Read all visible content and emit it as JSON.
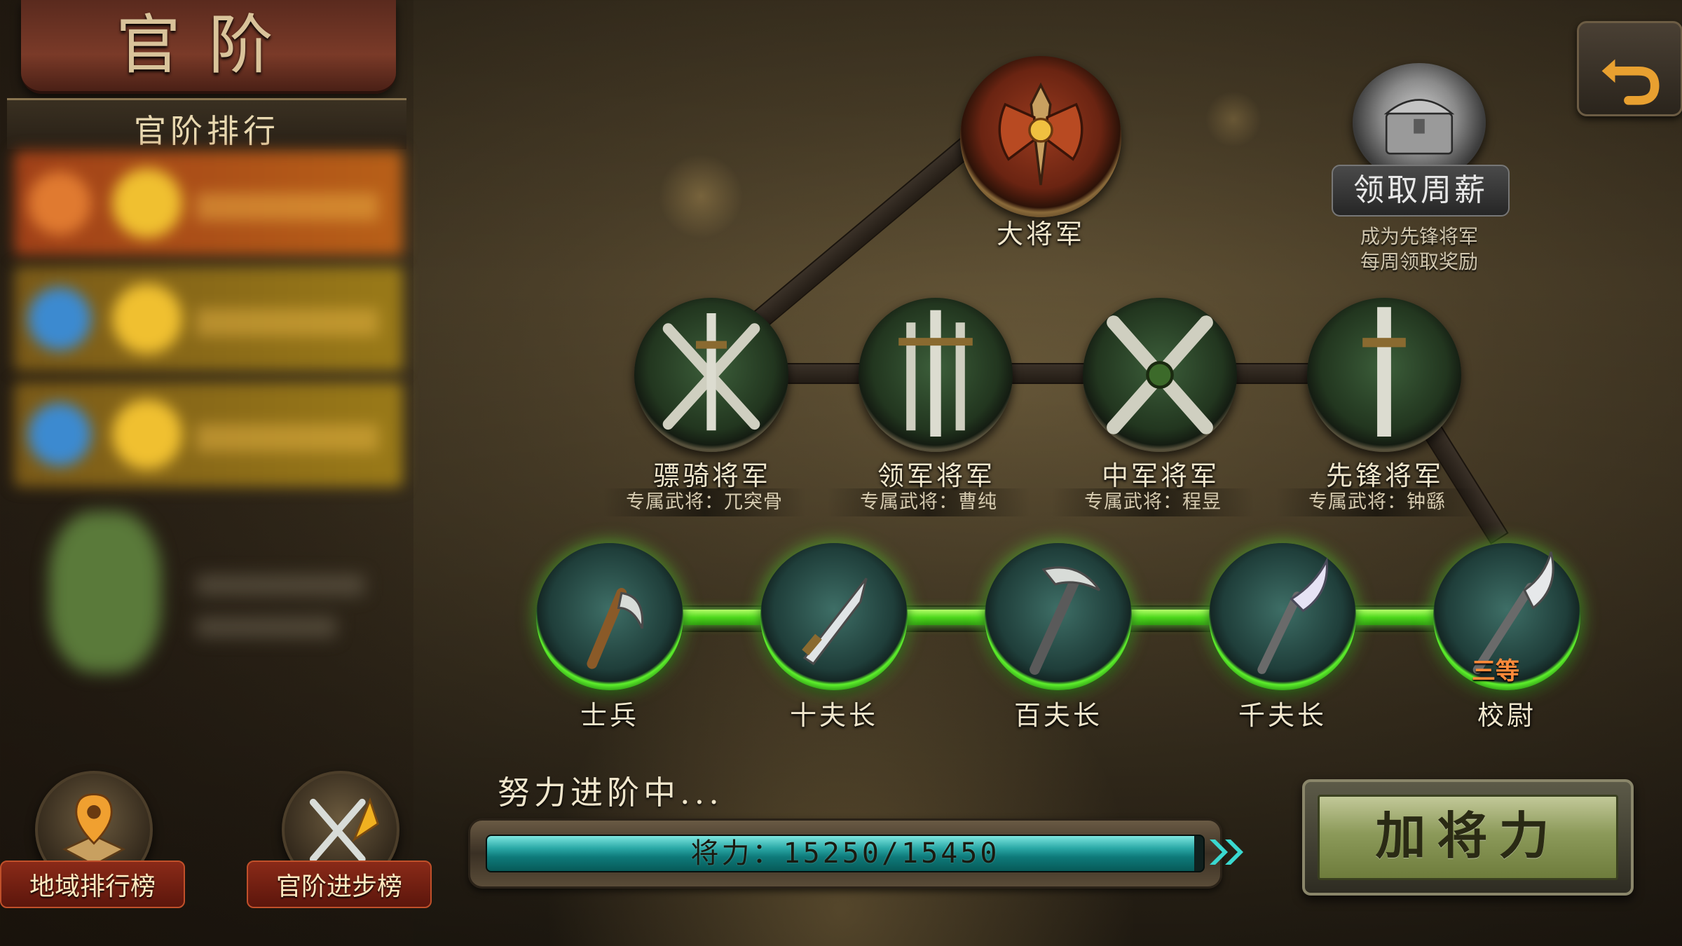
{
  "title": "官阶",
  "rank_panel": {
    "header": "官阶排行",
    "rows_blurred": 3
  },
  "top_rank": {
    "name": "大将军",
    "icon": "axe-emblem-icon"
  },
  "generals": [
    {
      "name": "骠骑将军",
      "exclusive": "专属武将：兀突骨",
      "icon": "crossed-swords-icon"
    },
    {
      "name": "领军将军",
      "exclusive": "专属武将：曹纯",
      "icon": "triple-swords-icon"
    },
    {
      "name": "中军将军",
      "exclusive": "专属武将：程昱",
      "icon": "crossed-swords-icon"
    },
    {
      "name": "先锋将军",
      "exclusive": "专属武将：钟繇",
      "icon": "single-sword-icon"
    }
  ],
  "soldier_ranks": [
    {
      "name": "士兵",
      "icon": "sickle-icon"
    },
    {
      "name": "十夫长",
      "icon": "dagger-icon"
    },
    {
      "name": "百夫长",
      "icon": "pickaxe-icon"
    },
    {
      "name": "千夫长",
      "icon": "glaive-icon"
    },
    {
      "name": "校尉",
      "icon": "halberd-icon",
      "badge": "三等"
    }
  ],
  "weekly_salary": {
    "label": "领取周薪",
    "note_line1": "成为先锋将军",
    "note_line2": "每周领取奖励",
    "icon": "treasure-chest-icon"
  },
  "bottom_buttons": [
    {
      "label": "地域排行榜",
      "icon": "map-pin-icon"
    },
    {
      "label": "官阶进步榜",
      "icon": "swords-arrow-icon"
    }
  ],
  "progress": {
    "caption": "努力进阶中...",
    "text": "将力：15250/15450",
    "current": 15250,
    "max": 15450
  },
  "power_button": "加将力",
  "back_icon": "return-arrow-icon",
  "colors": {
    "lit_green": "#5ef02c",
    "progress_teal": "#2aa8a6",
    "label_text": "#f0e6cc"
  }
}
